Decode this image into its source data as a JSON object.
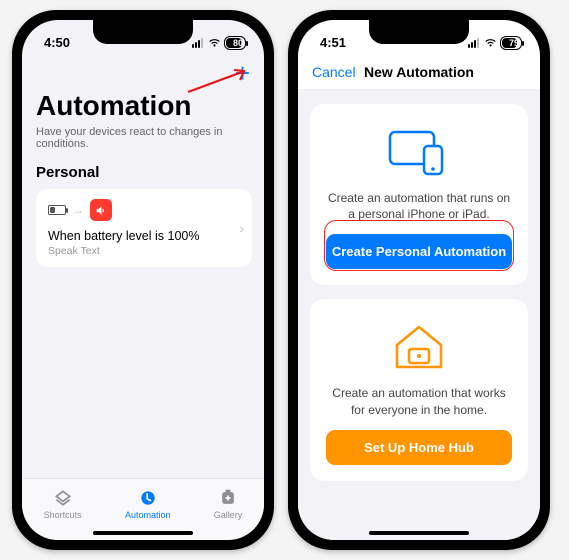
{
  "left": {
    "time": "4:50",
    "battery": "80",
    "title": "Automation",
    "subtitle": "Have your devices react to changes in conditions.",
    "section": "Personal",
    "card": {
      "title": "When battery level is 100%",
      "subtitle": "Speak Text"
    },
    "tabs": {
      "shortcuts": "Shortcuts",
      "automation": "Automation",
      "gallery": "Gallery"
    }
  },
  "right": {
    "time": "4:51",
    "battery": "79",
    "cancel": "Cancel",
    "title": "New Automation",
    "personal": {
      "desc": "Create an automation that runs on a personal iPhone or iPad.",
      "button": "Create Personal Automation"
    },
    "home": {
      "desc": "Create an automation that works for everyone in the home.",
      "button": "Set Up Home Hub"
    }
  }
}
